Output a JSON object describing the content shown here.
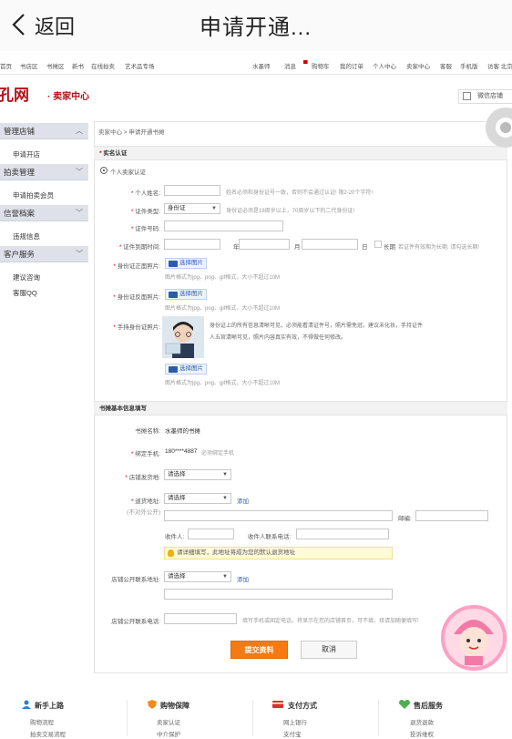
{
  "mobile_header": {
    "back_label": "返回",
    "title": "申请开通..."
  },
  "site_nav": {
    "left": [
      "首页",
      "书店区",
      "书摊区",
      "新书",
      "在线拍卖",
      "艺术品专场"
    ],
    "right": [
      "水墨师",
      "消息",
      "购物车",
      "我的订单",
      "个人中心",
      "卖家中心",
      "客服",
      "手机版",
      "访客 北京"
    ]
  },
  "brand": {
    "logo": "孔网",
    "subtitle": "· 卖家中心",
    "wechat_store": "微信店铺"
  },
  "sidebar": {
    "groups": [
      {
        "label": "管理店铺",
        "items": [
          "申请开店"
        ]
      },
      {
        "label": "拍卖管理",
        "items": [
          "申请拍卖会员"
        ]
      },
      {
        "label": "信誉档案",
        "items": [
          "违规信息"
        ]
      },
      {
        "label": "客户服务",
        "items": [
          "建议咨询",
          "客服QQ"
        ]
      }
    ]
  },
  "breadcrumb": "卖家中心 > 申请开通书摊",
  "realname": {
    "section_title": "实名认证",
    "radio_label": "个人卖家认证",
    "name_label": "个人姓名:",
    "name_hint": "姓名必须和身份证号一致，否则不会通过认证! 限2-20个字符!",
    "idtype_label": "证件类型:",
    "idtype_value": "身份证",
    "idtype_hint": "身份证必须是18周岁以上，70周岁以下的二代身份证!",
    "idnum_label": "证件号码:",
    "expiry_label": "证件到期时间:",
    "year": "年",
    "month": "月",
    "day": "日",
    "longterm": "长期",
    "expiry_hint": "若证件有效期为长期, 请勾选长期!",
    "front_label": "身份证正面照片:",
    "back_label": "身份证反面照片:",
    "hold_label": "手持身份证照片:",
    "upload_btn": "选择图片",
    "upload_hint": "图片格式为jpg、png、gif格式，大小不超过10M",
    "hold_desc_1": "身份证上的所有信息清晰可见，必须能看清证件号，照片需免冠，建议未化妆，手持证件",
    "hold_desc_2": "人五官清晰可见，照片内容真实有效，不得做任何修改。"
  },
  "stall": {
    "section_title": "书摊基本信息填写",
    "name_label": "书摊名称:",
    "name_value": "水墨师的书摊",
    "phone_label": "绑定手机:",
    "phone_value": "180****4887",
    "phone_hint": "必须绑定手机",
    "ship_label": "店铺发货地:",
    "select_placeholder": "请选择",
    "return_label": "退货地址:",
    "return_note": "(不对外公开)",
    "add_link": "添加",
    "zip_label": "邮编:",
    "receiver_label": "收件人:",
    "receiver_phone_label": "收件人联系电话:",
    "warn": "请详细填写，此地址将成为您的默认退货地址",
    "public_addr_label": "店铺公开联系地址:",
    "public_phone_label": "店铺公开联系电话:",
    "public_phone_hint": "填写手机或固定电话，将显示在您的店铺首页，可不填，择请加随便填写!",
    "submit": "提交资料",
    "cancel": "取消"
  },
  "footer": [
    {
      "title": "新手上路",
      "links": [
        "购物流程",
        "拍卖交易流程"
      ]
    },
    {
      "title": "购物保障",
      "links": [
        "卖家认证",
        "中介保护"
      ]
    },
    {
      "title": "支付方式",
      "links": [
        "网上银行",
        "支付宝"
      ]
    },
    {
      "title": "售后服务",
      "links": [
        "退货退款",
        "投诉维权"
      ]
    }
  ],
  "colors": {
    "brand_red": "#b5121b",
    "submit_orange": "#f57a12",
    "link_blue": "#2a5caa",
    "sidebar_bg": "#dfe1ea"
  }
}
